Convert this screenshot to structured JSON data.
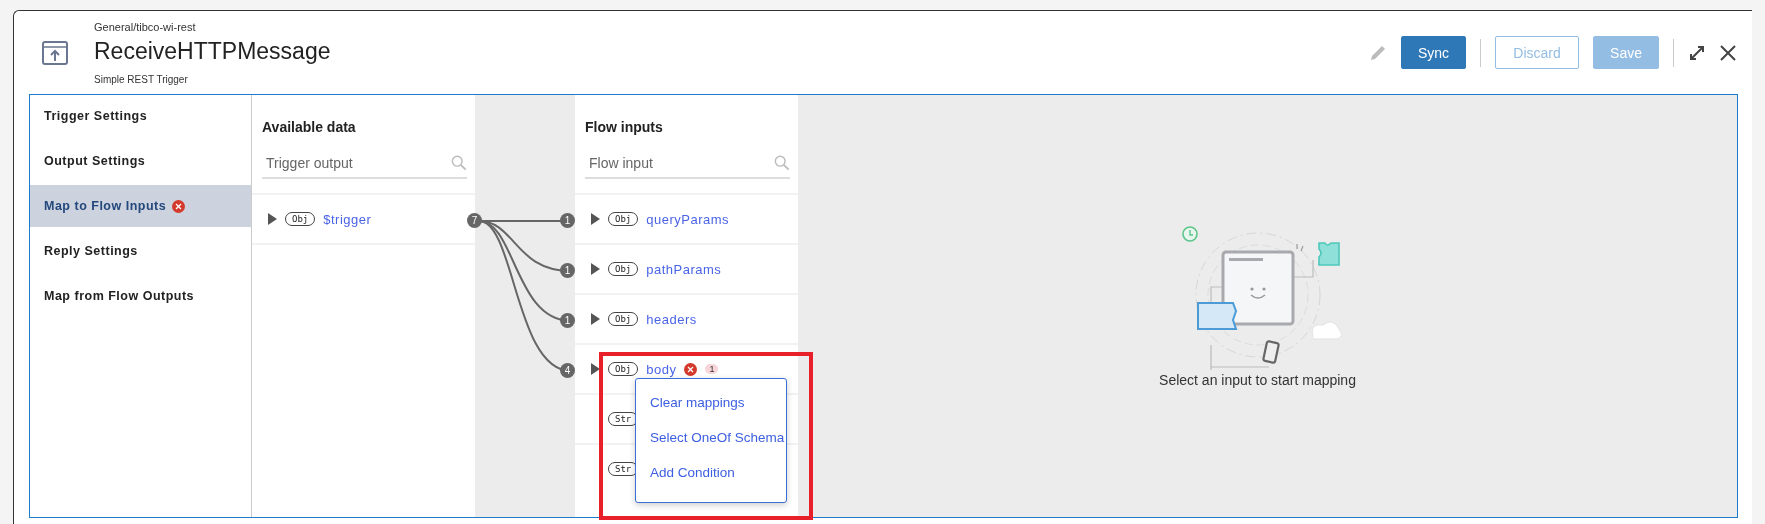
{
  "header": {
    "breadcrumb": "General/tibco-wi-rest",
    "title": "ReceiveHTTPMessage",
    "subtitle": "Simple REST Trigger",
    "buttons": [
      {
        "label": "Sync",
        "kind": "primary",
        "disabled": false
      },
      {
        "label": "Discard",
        "kind": "outline",
        "disabled": true
      },
      {
        "label": "Save",
        "kind": "primary",
        "disabled": true
      }
    ]
  },
  "sidebar": {
    "items": [
      {
        "label": "Trigger Settings",
        "selected": false,
        "error": false
      },
      {
        "label": "Output Settings",
        "selected": false,
        "error": false
      },
      {
        "label": "Map to Flow Inputs",
        "selected": true,
        "error": true
      },
      {
        "label": "Reply Settings",
        "selected": false,
        "error": false
      },
      {
        "label": "Map from Flow Outputs",
        "selected": false,
        "error": false
      }
    ]
  },
  "available_data": {
    "title": "Available data",
    "search": {
      "placeholder": "Trigger output"
    },
    "rows": [
      {
        "type": "Obj",
        "name": "$trigger",
        "mapped_count": "7",
        "expandable": true
      }
    ]
  },
  "flow_inputs": {
    "title": "Flow inputs",
    "search": {
      "placeholder": "Flow input"
    },
    "rows": [
      {
        "type": "Obj",
        "name": "queryParams",
        "mapped_count": "1",
        "expandable": true,
        "error": false
      },
      {
        "type": "Obj",
        "name": "pathParams",
        "mapped_count": "1",
        "expandable": true,
        "error": false
      },
      {
        "type": "Obj",
        "name": "headers",
        "mapped_count": "1",
        "expandable": true,
        "error": false
      },
      {
        "type": "Obj",
        "name": "body",
        "mapped_count": "4",
        "expandable": true,
        "error": true,
        "issue_count": "1"
      },
      {
        "type": "Str",
        "expandable": false
      },
      {
        "type": "Str",
        "expandable": false
      }
    ]
  },
  "context_menu": {
    "items": [
      "Clear mappings",
      "Select OneOf Schema",
      "Add Condition"
    ]
  },
  "empty_state": {
    "message": "Select an input to start mapping"
  }
}
